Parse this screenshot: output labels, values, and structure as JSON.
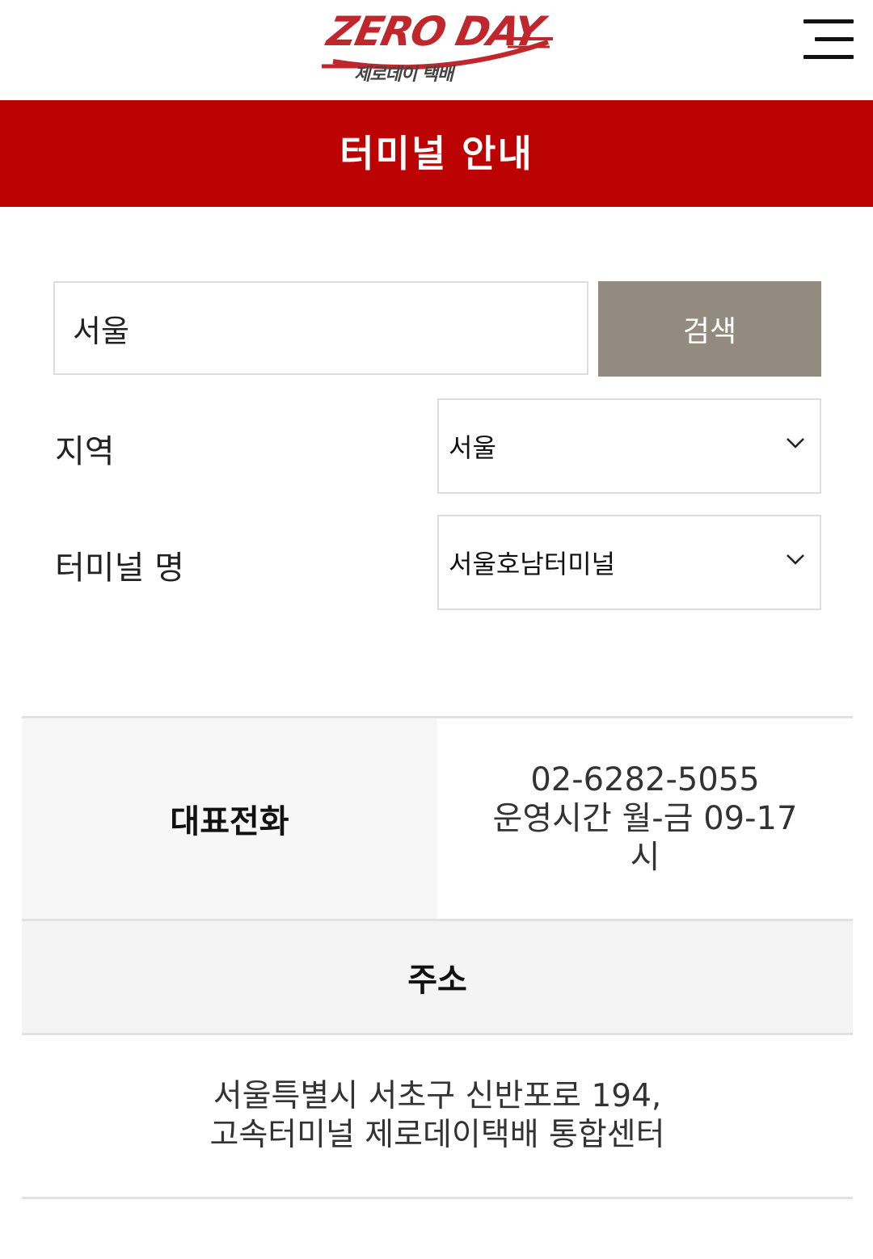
{
  "header": {
    "logo_text": "ZERO DAY",
    "logo_subtext": "제로데이 택배",
    "menu_icon": "hamburger-menu-icon",
    "logo_color": "#c0272d"
  },
  "banner": {
    "title": "터미널 안내",
    "background_color": "#bb0303"
  },
  "search": {
    "input_value": "서울",
    "button_label": "검색",
    "button_color": "#948b80"
  },
  "filters": {
    "region_label": "지역",
    "region_value": "서울",
    "terminal_label": "터미널 명",
    "terminal_value": "서울호남터미널",
    "dropdown_icon": "chevron-down-icon"
  },
  "info": {
    "phone_label": "대표전화",
    "phone_number": "02-6282-5055",
    "hours": "운영시간 월-금 09-17시",
    "address_label": "주소",
    "address_line1": "서울특별시 서초구 신반포로 194,",
    "address_line2": "고속터미널 제로데이택배 통합센터"
  }
}
